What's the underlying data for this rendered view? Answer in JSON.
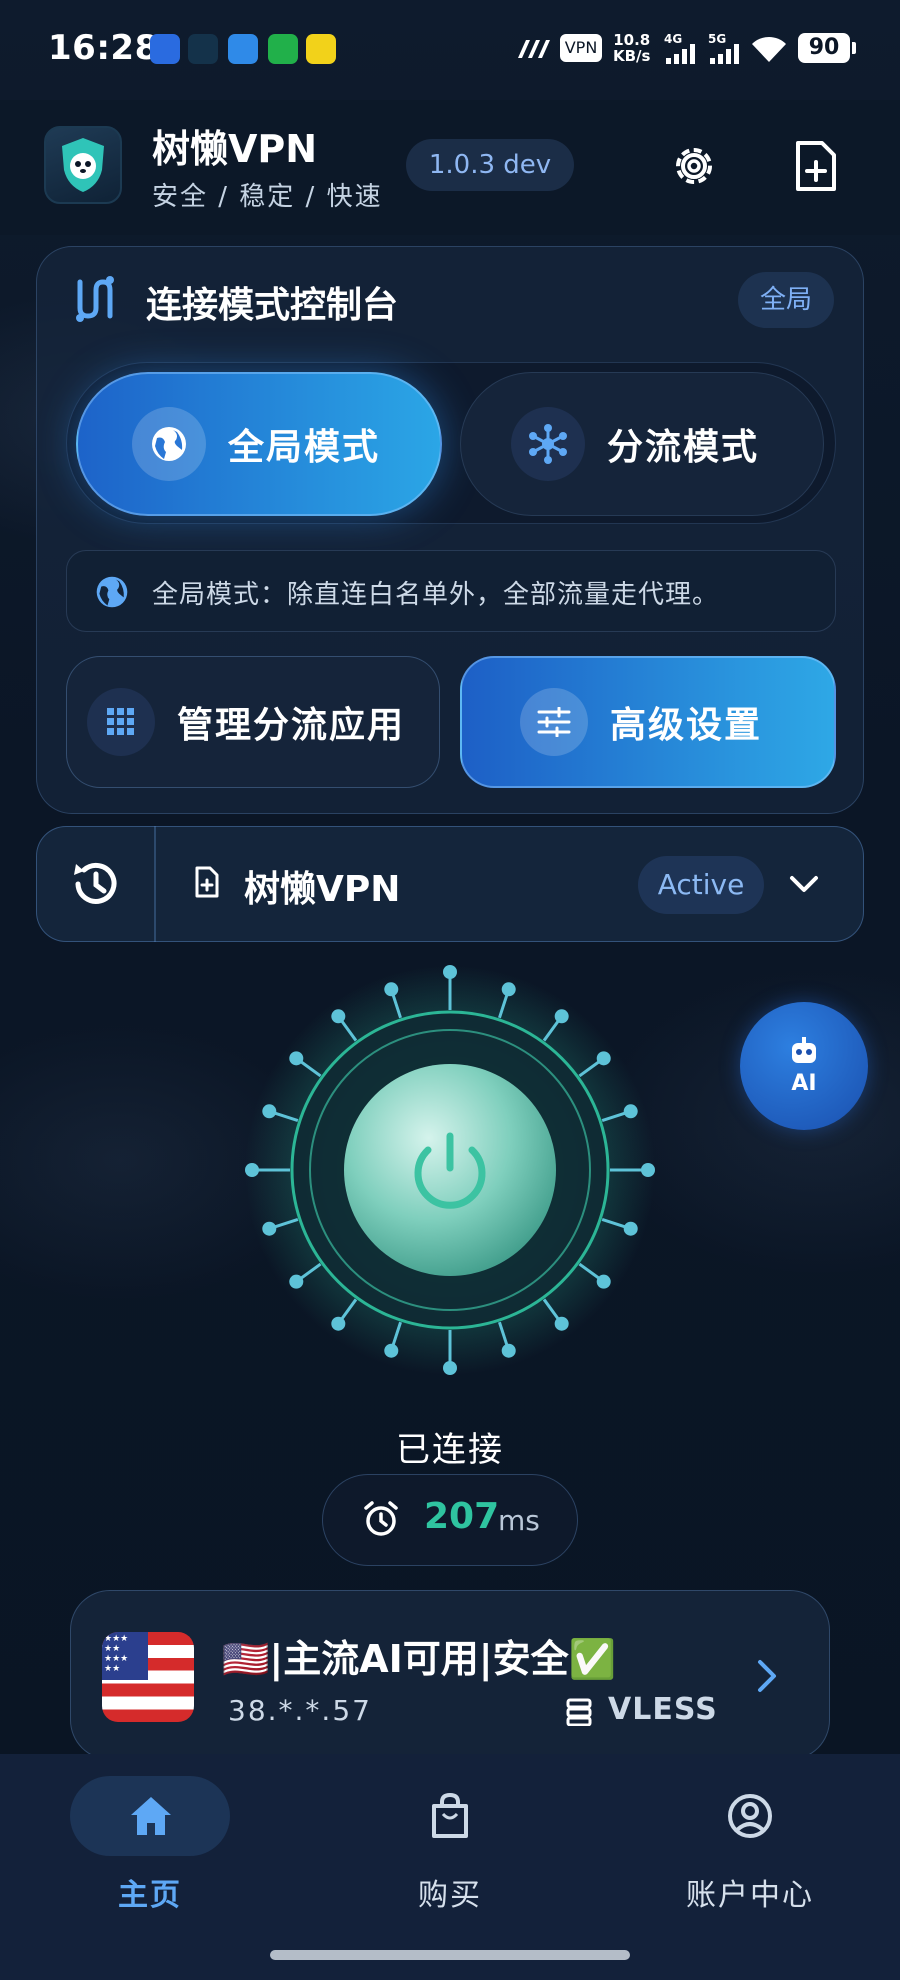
{
  "status_bar": {
    "time": "16:28",
    "vpn": "VPN",
    "speed_value": "10.8",
    "speed_unit": "KB/s",
    "net1": "4G",
    "net2": "5G",
    "battery": "90"
  },
  "header": {
    "app_name": "树懒VPN",
    "tagline": "安全 / 稳定 / 快速",
    "version": "1.0.3 dev"
  },
  "console": {
    "title": "连接模式控制台",
    "badge": "全局",
    "modes": [
      {
        "label": "全局模式",
        "active": true
      },
      {
        "label": "分流模式",
        "active": false
      }
    ],
    "description": "全局模式：除直连白名单外，全部流量走代理。",
    "manage_label": "管理分流应用",
    "advanced_label": "高级设置"
  },
  "profile": {
    "name": "树懒VPN",
    "status": "Active"
  },
  "ai_label": "AI",
  "connection": {
    "status": "已连接",
    "latency": "207",
    "latency_unit": "ms"
  },
  "server": {
    "title": "🇺🇸|主流AI可用|安全✅",
    "ip": "38.*.*.57",
    "protocol": "VLESS"
  },
  "nav": [
    {
      "label": "主页",
      "active": true
    },
    {
      "label": "购买",
      "active": false
    },
    {
      "label": "账户中心",
      "active": false
    }
  ],
  "colors": {
    "accent": "#2a8fe0",
    "connected": "#2fc4a0",
    "nav_active": "#5ea8f5"
  }
}
